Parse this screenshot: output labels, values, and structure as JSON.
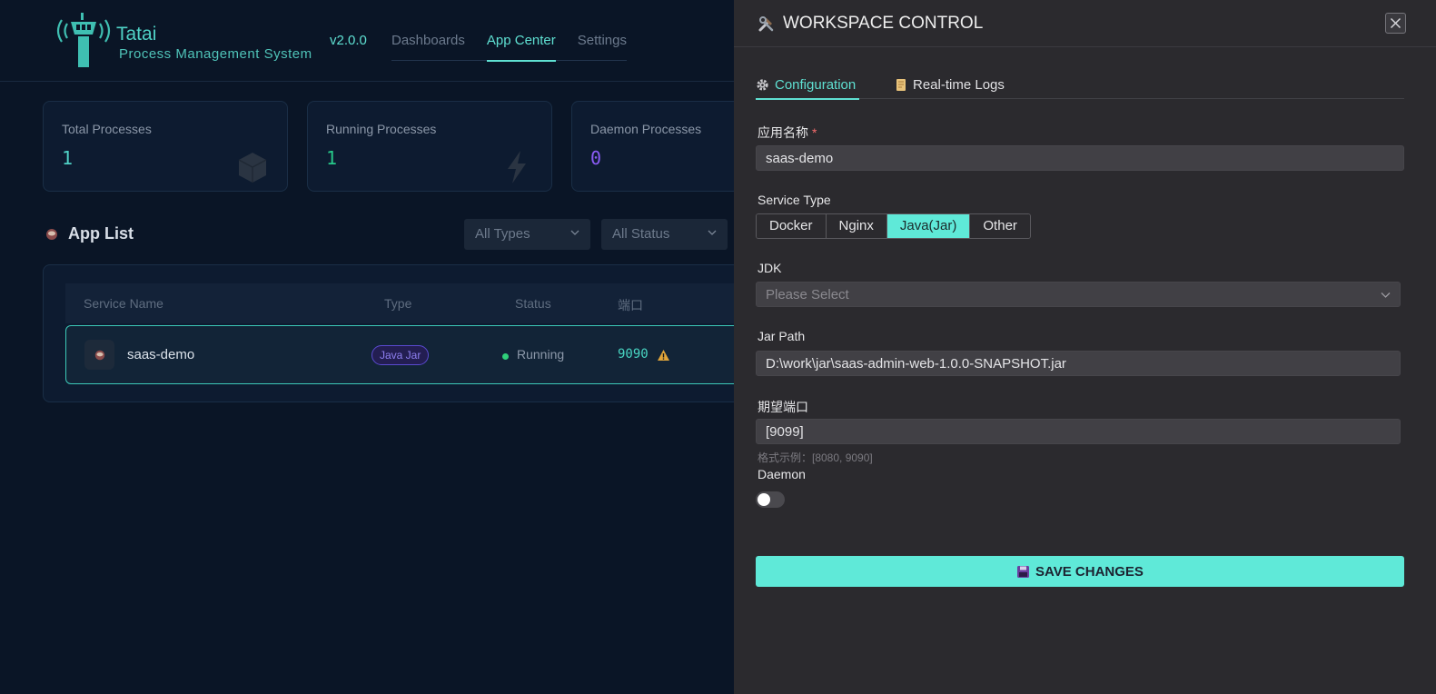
{
  "app": {
    "brand_name": "Tatai",
    "brand_sub": "Process Management System",
    "version": "v2.0.0",
    "nav": [
      "Dashboards",
      "App Center",
      "Settings"
    ],
    "active_nav": "App Center"
  },
  "stats": [
    {
      "label": "Total Processes",
      "value": "1",
      "color": "#4fd1c5",
      "icon": "box-icon"
    },
    {
      "label": "Running Processes",
      "value": "1",
      "color": "#27c98a",
      "icon": "lightning-icon"
    },
    {
      "label": "Daemon Processes",
      "value": "0",
      "color": "#8b5cf6",
      "icon": "shield-icon"
    }
  ],
  "app_list": {
    "title": "App List",
    "filters": {
      "type": "All Types",
      "status": "All Status"
    },
    "columns": [
      "Service Name",
      "Type",
      "Status",
      "端口"
    ],
    "rows": [
      {
        "name": "saas-demo",
        "type": "Java Jar",
        "status": "Running",
        "port": "9090"
      }
    ]
  },
  "drawer": {
    "title": "WORKSPACE CONTROL",
    "tabs": [
      "Configuration",
      "Real-time Logs"
    ],
    "active_tab": "Configuration",
    "fields": {
      "app_name": {
        "label": "应用名称",
        "value": "saas-demo",
        "required": true
      },
      "service_type": {
        "label": "Service Type",
        "options": [
          "Docker",
          "Nginx",
          "Java(Jar)",
          "Other"
        ],
        "selected": "Java(Jar)"
      },
      "jdk": {
        "label": "JDK",
        "placeholder": "Please Select"
      },
      "jar_path": {
        "label": "Jar Path",
        "value": "D:\\work\\jar\\saas-admin-web-1.0.0-SNAPSHOT.jar"
      },
      "port": {
        "label": "期望端口",
        "value": "[9099]",
        "hint": "格式示例：[8080, 9090]"
      },
      "daemon": {
        "label": "Daemon",
        "enabled": false
      }
    },
    "save_label": "SAVE CHANGES"
  },
  "colors": {
    "accent": "#5fe9d8",
    "drawer_bg": "#2b2a2e",
    "app_bg": "#0a1526"
  }
}
